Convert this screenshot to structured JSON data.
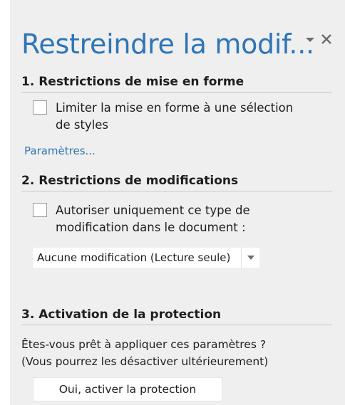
{
  "pane": {
    "title": "Restreindre la modif...",
    "menu_icon": "dropdown-triangle-icon",
    "close_icon": "close-icon",
    "accent_color": "#2e75b6",
    "background_color": "#efefef"
  },
  "formatting": {
    "heading": "1. Restrictions de mise en forme",
    "checkbox_label": "Limiter la mise en forme à une sélection\nde styles",
    "checked": false,
    "settings_link": "Paramètres..."
  },
  "editing": {
    "heading": "2. Restrictions de modifications",
    "checkbox_label": "Autoriser uniquement ce type de\nmodification dans le document :",
    "checked": false,
    "select_value": "Aucune modification (Lecture seule)"
  },
  "protection": {
    "heading": "3. Activation de la protection",
    "description": "Êtes-vous prêt à appliquer ces paramètres ?\n(Vous pourrez les désactiver ultérieurement)",
    "button_label": "Oui, activer la protection"
  }
}
